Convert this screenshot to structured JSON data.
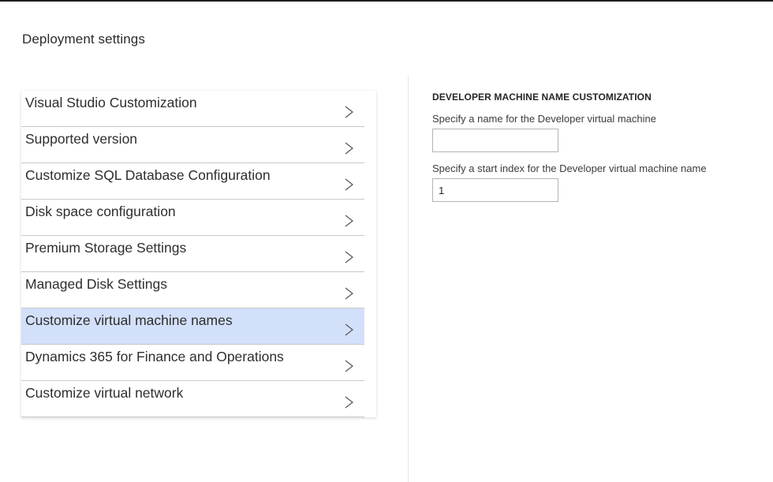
{
  "page": {
    "title": "Deployment settings"
  },
  "settings_list": {
    "items": [
      {
        "label": "Visual Studio Customization",
        "selected": false
      },
      {
        "label": "Supported version",
        "selected": false
      },
      {
        "label": "Customize SQL Database Configuration",
        "selected": false
      },
      {
        "label": "Disk space configuration",
        "selected": false
      },
      {
        "label": "Premium Storage Settings",
        "selected": false
      },
      {
        "label": "Managed Disk Settings",
        "selected": false
      },
      {
        "label": "Customize virtual machine names",
        "selected": true
      },
      {
        "label": "Dynamics 365 for Finance and Operations",
        "selected": false
      },
      {
        "label": "Customize virtual network",
        "selected": false
      }
    ],
    "chevron_icon": "chevron-right-icon",
    "selected_color": "#d3e0fa"
  },
  "detail": {
    "heading": "DEVELOPER MACHINE NAME CUSTOMIZATION",
    "name_field": {
      "label": "Specify a name for the Developer virtual machine",
      "value": ""
    },
    "start_index_field": {
      "label": "Specify a start index for the Developer virtual machine name",
      "value": "1"
    }
  }
}
